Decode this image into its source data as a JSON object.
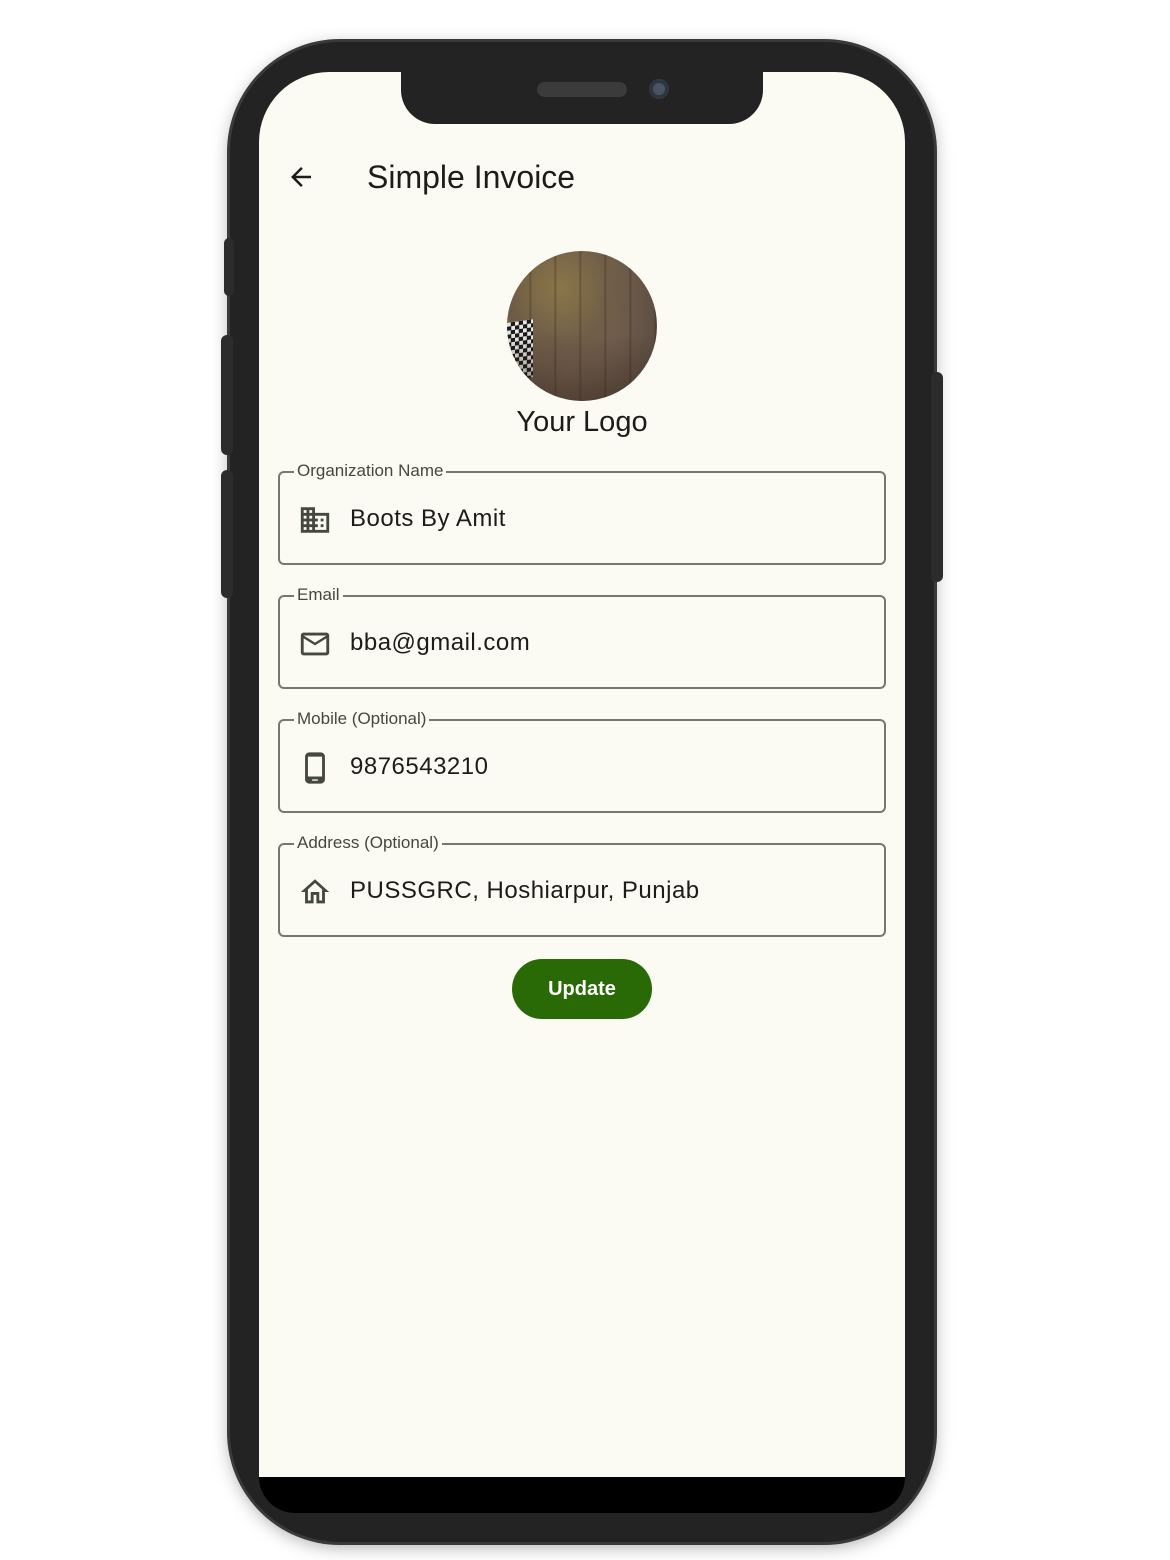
{
  "appbar": {
    "title": "Simple Invoice",
    "back_icon": "arrow-back-icon"
  },
  "logo": {
    "label": "Your Logo"
  },
  "form": {
    "organization": {
      "label": "Organization Name",
      "value": "Boots By Amit",
      "icon": "business-icon"
    },
    "email": {
      "label": "Email",
      "value": "bba@gmail.com",
      "icon": "mail-icon"
    },
    "mobile": {
      "label": "Mobile (Optional)",
      "value": "9876543210",
      "icon": "smartphone-icon"
    },
    "address": {
      "label": "Address (Optional)",
      "value": "PUSSGRC, Hoshiarpur, Punjab",
      "icon": "home-icon"
    }
  },
  "update_button": {
    "label": "Update"
  },
  "colors": {
    "background": "#fbfaf3",
    "primary_button": "#2a6a06",
    "outline": "#75786e",
    "text": "#1d1c17",
    "phone_frame": "#232323"
  }
}
